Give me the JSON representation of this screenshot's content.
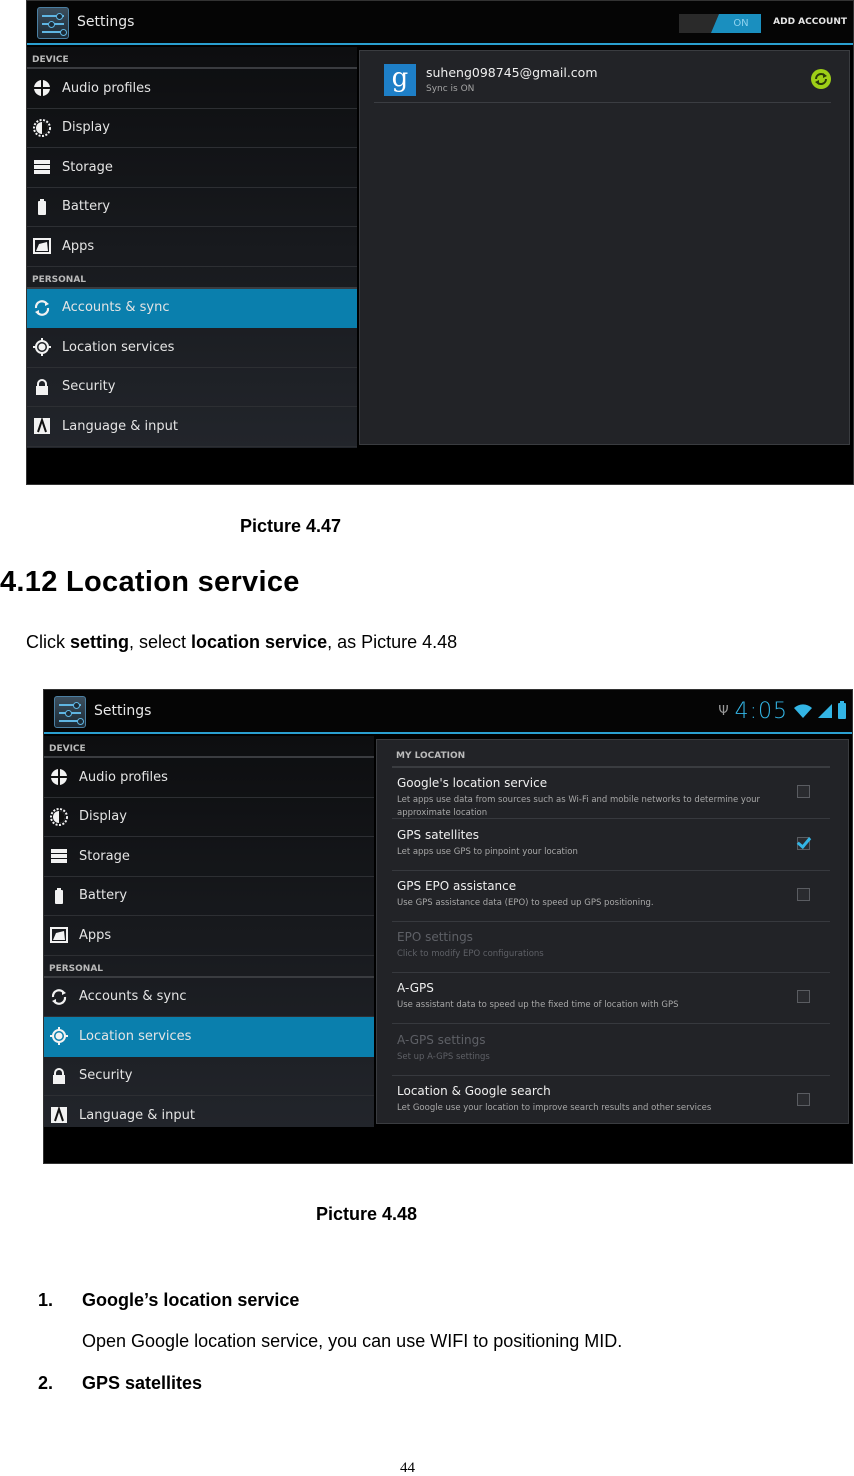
{
  "picture1": {
    "app_title": "Settings",
    "toggle_label": "ON",
    "add_account": "ADD ACCOUNT",
    "section_device": "DEVICE",
    "section_personal": "PERSONAL",
    "device_items": [
      {
        "label": "Audio profiles",
        "icon": "audio-profiles-icon"
      },
      {
        "label": "Display",
        "icon": "display-icon"
      },
      {
        "label": "Storage",
        "icon": "storage-icon"
      },
      {
        "label": "Battery",
        "icon": "battery-icon"
      },
      {
        "label": "Apps",
        "icon": "apps-icon"
      }
    ],
    "personal_items": [
      {
        "label": "Accounts & sync",
        "icon": "sync-icon",
        "active": true
      },
      {
        "label": "Location services",
        "icon": "location-icon",
        "active": false
      },
      {
        "label": "Security",
        "icon": "lock-icon",
        "active": false
      },
      {
        "label": "Language & input",
        "icon": "language-icon",
        "active": false
      }
    ],
    "account": {
      "email": "suheng098745@gmail.com",
      "status": "Sync is ON"
    },
    "accent_color": "#0a7fad",
    "sync_color": "#9ecf17"
  },
  "caption1": "Picture 4.47",
  "section_heading": "4.12 Location service",
  "intro": {
    "p1": "Click ",
    "b1": "setting",
    "p2": ", select ",
    "b2": "location service",
    "p3": ", as Picture 4.48"
  },
  "picture2": {
    "app_title": "Settings",
    "clock": "4:05",
    "section_device": "DEVICE",
    "section_personal": "PERSONAL",
    "device_items": [
      {
        "label": "Audio profiles"
      },
      {
        "label": "Display"
      },
      {
        "label": "Storage"
      },
      {
        "label": "Battery"
      },
      {
        "label": "Apps"
      }
    ],
    "personal_items": [
      {
        "label": "Accounts & sync"
      },
      {
        "label": "Location services"
      },
      {
        "label": "Security"
      },
      {
        "label": "Language & input"
      }
    ],
    "my_location_header": "MY LOCATION",
    "prefs": [
      {
        "title": "Google's location service",
        "summary": "Let apps use data from sources such as Wi-Fi and mobile networks to determine your approximate location",
        "checkbox": true,
        "checked": false,
        "enabled": true
      },
      {
        "title": "GPS satellites",
        "summary": "Let apps use GPS to pinpoint your location",
        "checkbox": true,
        "checked": true,
        "enabled": true
      },
      {
        "title": "GPS EPO assistance",
        "summary": "Use GPS assistance data (EPO) to speed up GPS positioning.",
        "checkbox": true,
        "checked": false,
        "enabled": true
      },
      {
        "title": "EPO settings",
        "summary": "Click to modify EPO configurations",
        "checkbox": false,
        "enabled": false
      },
      {
        "title": "A-GPS",
        "summary": "Use assistant data to speed up the fixed time of location with GPS",
        "checkbox": true,
        "checked": false,
        "enabled": true
      },
      {
        "title": "A-GPS settings",
        "summary": "Set up A-GPS settings",
        "checkbox": false,
        "enabled": false
      },
      {
        "title": "Location & Google search",
        "summary": "Let Google use your location to improve search results and other services",
        "checkbox": true,
        "checked": false,
        "enabled": true
      }
    ]
  },
  "caption2": "Picture 4.48",
  "list": [
    {
      "num": "1.",
      "title": "Google’s location service",
      "desc": "Open Google location service, you can use WIFI to positioning MID."
    },
    {
      "num": "2.",
      "title": "GPS satellites"
    }
  ],
  "page_number": "44"
}
